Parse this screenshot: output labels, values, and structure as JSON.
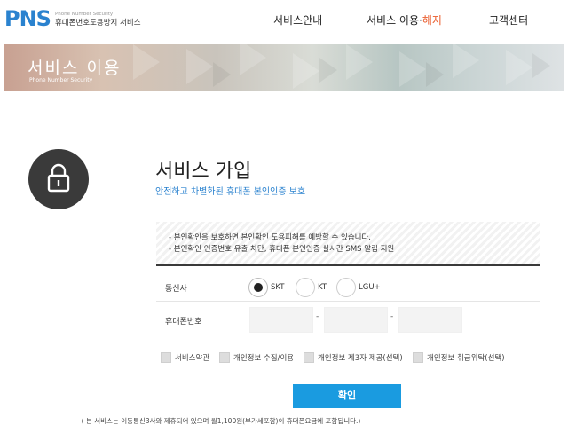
{
  "header": {
    "logo_mark": "PNS",
    "logo_sub": "Phone Number Security",
    "logo_main": "휴대폰번호도용방지 서비스",
    "nav": [
      {
        "label": "서비스안내"
      },
      {
        "label_main": "서비스 이용·",
        "label_accent": "해지"
      },
      {
        "label": "고객센터"
      }
    ]
  },
  "banner": {
    "title": "서비스 이용",
    "subtitle": "Phone Number Security"
  },
  "main": {
    "title": "서비스 가입",
    "subtitle": "안전하고 차별화된 휴대폰 본인인증 보호",
    "notice": [
      "- 본인확인을 보호하면 본인확인 도용피해를 예방할 수 있습니다.",
      "- 본인확인 인증번호 유출 차단, 휴대폰 본인인증 실시간 SMS 알림 지원"
    ],
    "carrier_label": "통신사",
    "carriers": [
      {
        "label": "SKT",
        "selected": true
      },
      {
        "label": "KT",
        "selected": false
      },
      {
        "label": "LGU+",
        "selected": false
      }
    ],
    "phone_label": "휴대폰번호",
    "phone_dash": "-",
    "agreements": [
      "서비스약관",
      "개인정보 수집/이용",
      "개인정보 제3자 제공(선택)",
      "개인정보 취급위탁(선택)"
    ],
    "submit_label": "확인",
    "footnote": "( 본 서비스는 이동통신3사와 제휴되어 있으며 월1,100원(부가세포함)이 휴대폰요금에 포함됩니다.)"
  },
  "colors": {
    "brand": "#2a82cf",
    "accent": "#ea5a2a",
    "button": "#1a9be0",
    "icon_bg": "#3a3a3a"
  },
  "icons": {
    "lock": "lock-icon"
  }
}
